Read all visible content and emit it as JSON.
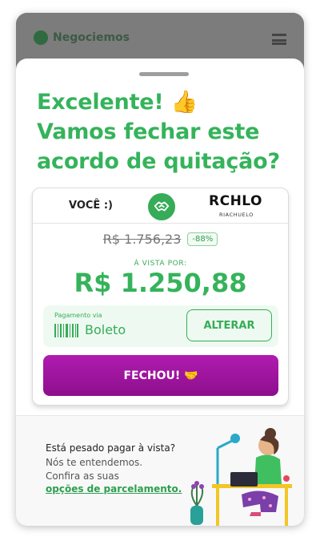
{
  "header": {
    "logo_text": "Negociemos",
    "menu_icon": "hamburger-menu-icon"
  },
  "modal": {
    "headline_line1": "Excelente! 👍",
    "headline_line2": "Vamos fechar este",
    "headline_line3": "acordo de quitação?"
  },
  "card": {
    "you_label": "VOCÊ :)",
    "deal_icon": "handshake-icon",
    "brand_name": "RCHLO",
    "brand_sub": "RIACHUELO",
    "old_price": "R$ 1.756,23",
    "discount": "-88%",
    "cash_label": "À VISTA POR:",
    "price": "R$ 1.250,88",
    "payment_label": "Pagamento via",
    "payment_method": "Boleto",
    "change_button": "ALTERAR",
    "confirm_button": "FECHOU! 🤝"
  },
  "footer": {
    "heavy_text": "Está pesado pagar à vista?",
    "understand_text": "Nós te entendemos.",
    "check_text": "Confira as suas",
    "installments_link": "opções de parcelamento."
  },
  "colors": {
    "accent_green": "#35b35b",
    "confirm_purple": "#a016a0"
  }
}
